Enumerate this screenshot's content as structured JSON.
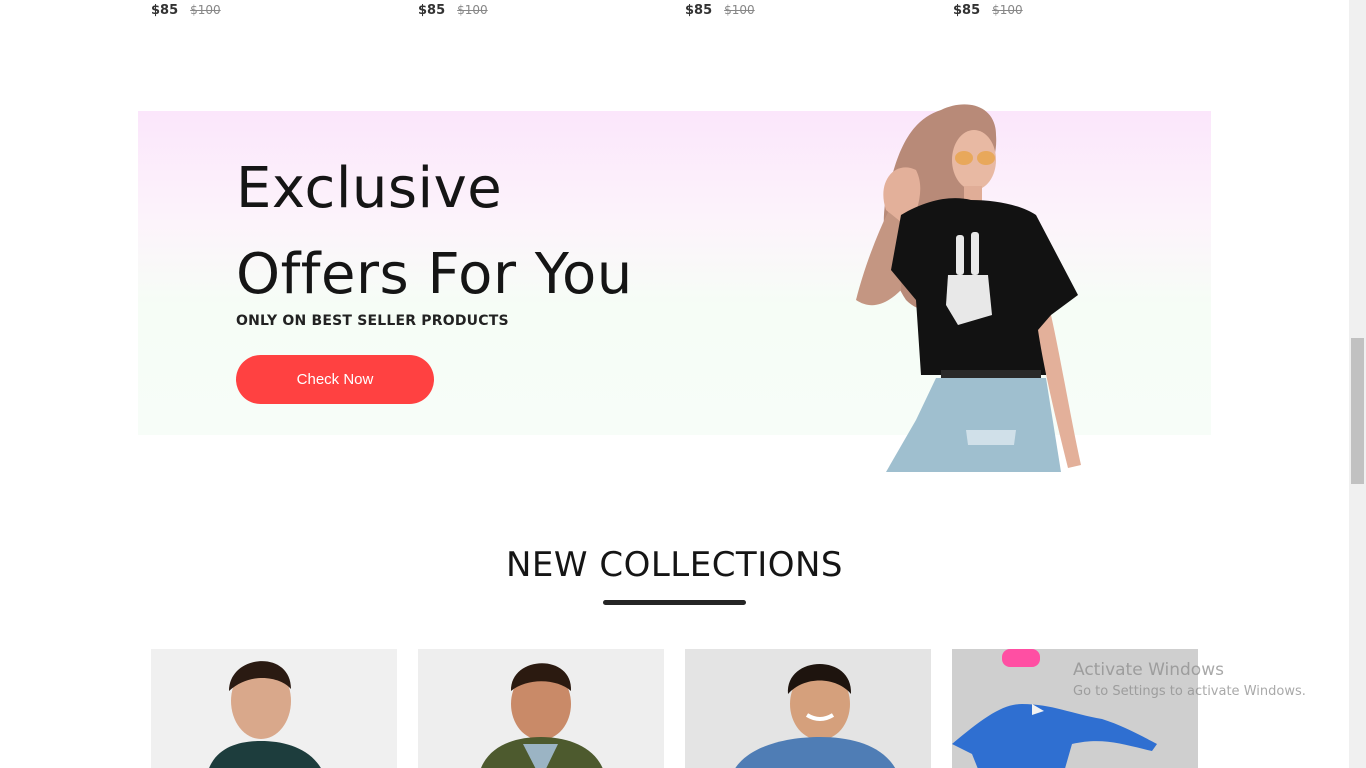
{
  "prices": [
    {
      "current": "$85",
      "original": "$100"
    },
    {
      "current": "$85",
      "original": "$100"
    },
    {
      "current": "$85",
      "original": "$100"
    },
    {
      "current": "$85",
      "original": "$100"
    }
  ],
  "banner": {
    "title_line1": "Exclusive",
    "title_line2": "Offers For You",
    "subtitle": "ONLY ON BEST SELLER PRODUCTS",
    "cta_label": "Check Now"
  },
  "new_collections": {
    "title": "NEW COLLECTIONS"
  },
  "watermark": {
    "line1": "Activate Windows",
    "line2": "Go to Settings to activate Windows."
  },
  "colors": {
    "accent": "#ff4141",
    "banner_top": "#fbe6fb",
    "banner_bottom": "#f6fdf6"
  }
}
